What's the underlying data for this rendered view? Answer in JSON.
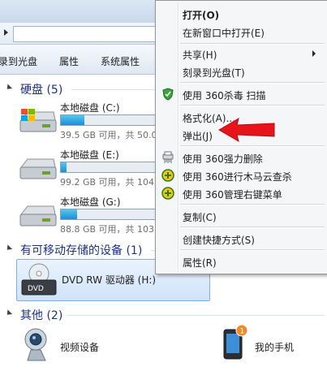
{
  "toolbar": {
    "burn": "录到光盘",
    "properties": "属性",
    "system_properties": "系统属性"
  },
  "sections": {
    "hard_disks": "硬盘 (5)",
    "removable": "有可移动存储的设备 (1)",
    "other": "其他 (2)"
  },
  "drives": [
    {
      "name": "本地磁盘 (C:)",
      "info": "39.5 GB 可用，共 50.0",
      "used_fraction": 0.21
    },
    {
      "name": "本地磁盘 (E:)",
      "info": "99.2 GB 可用，共 104",
      "used_fraction": 0.05
    },
    {
      "name": "本地磁盘 (G:)",
      "info": "88.8 GB 可用，共 103",
      "used_fraction": 0.14
    }
  ],
  "dvd": {
    "name": "DVD RW 驱动器 (H:)",
    "label": "DVD"
  },
  "other_items": [
    {
      "name": "视频设备"
    },
    {
      "name": "我的手机",
      "badge": "1"
    }
  ],
  "context_menu": {
    "open": "打开(O)",
    "open_new_window": "在新窗口中打开(E)",
    "share": "共享(H)",
    "burn": "刻录到光盘(T)",
    "scan_360": "使用 360杀毒 扫描",
    "format": "格式化(A)...",
    "eject": "弹出(J)",
    "force_delete_360": "使用 360强力删除",
    "trojan_scan_360": "使用 360进行木马云查杀",
    "manage_menu_360": "使用 360管理右键菜单",
    "copy": "复制(C)",
    "create_shortcut": "创建快捷方式(S)",
    "properties": "属性(R)"
  },
  "colors": {
    "accent": "#1e3287",
    "annotation_arrow": "#e8141c",
    "selection": "#cfe3fa"
  }
}
